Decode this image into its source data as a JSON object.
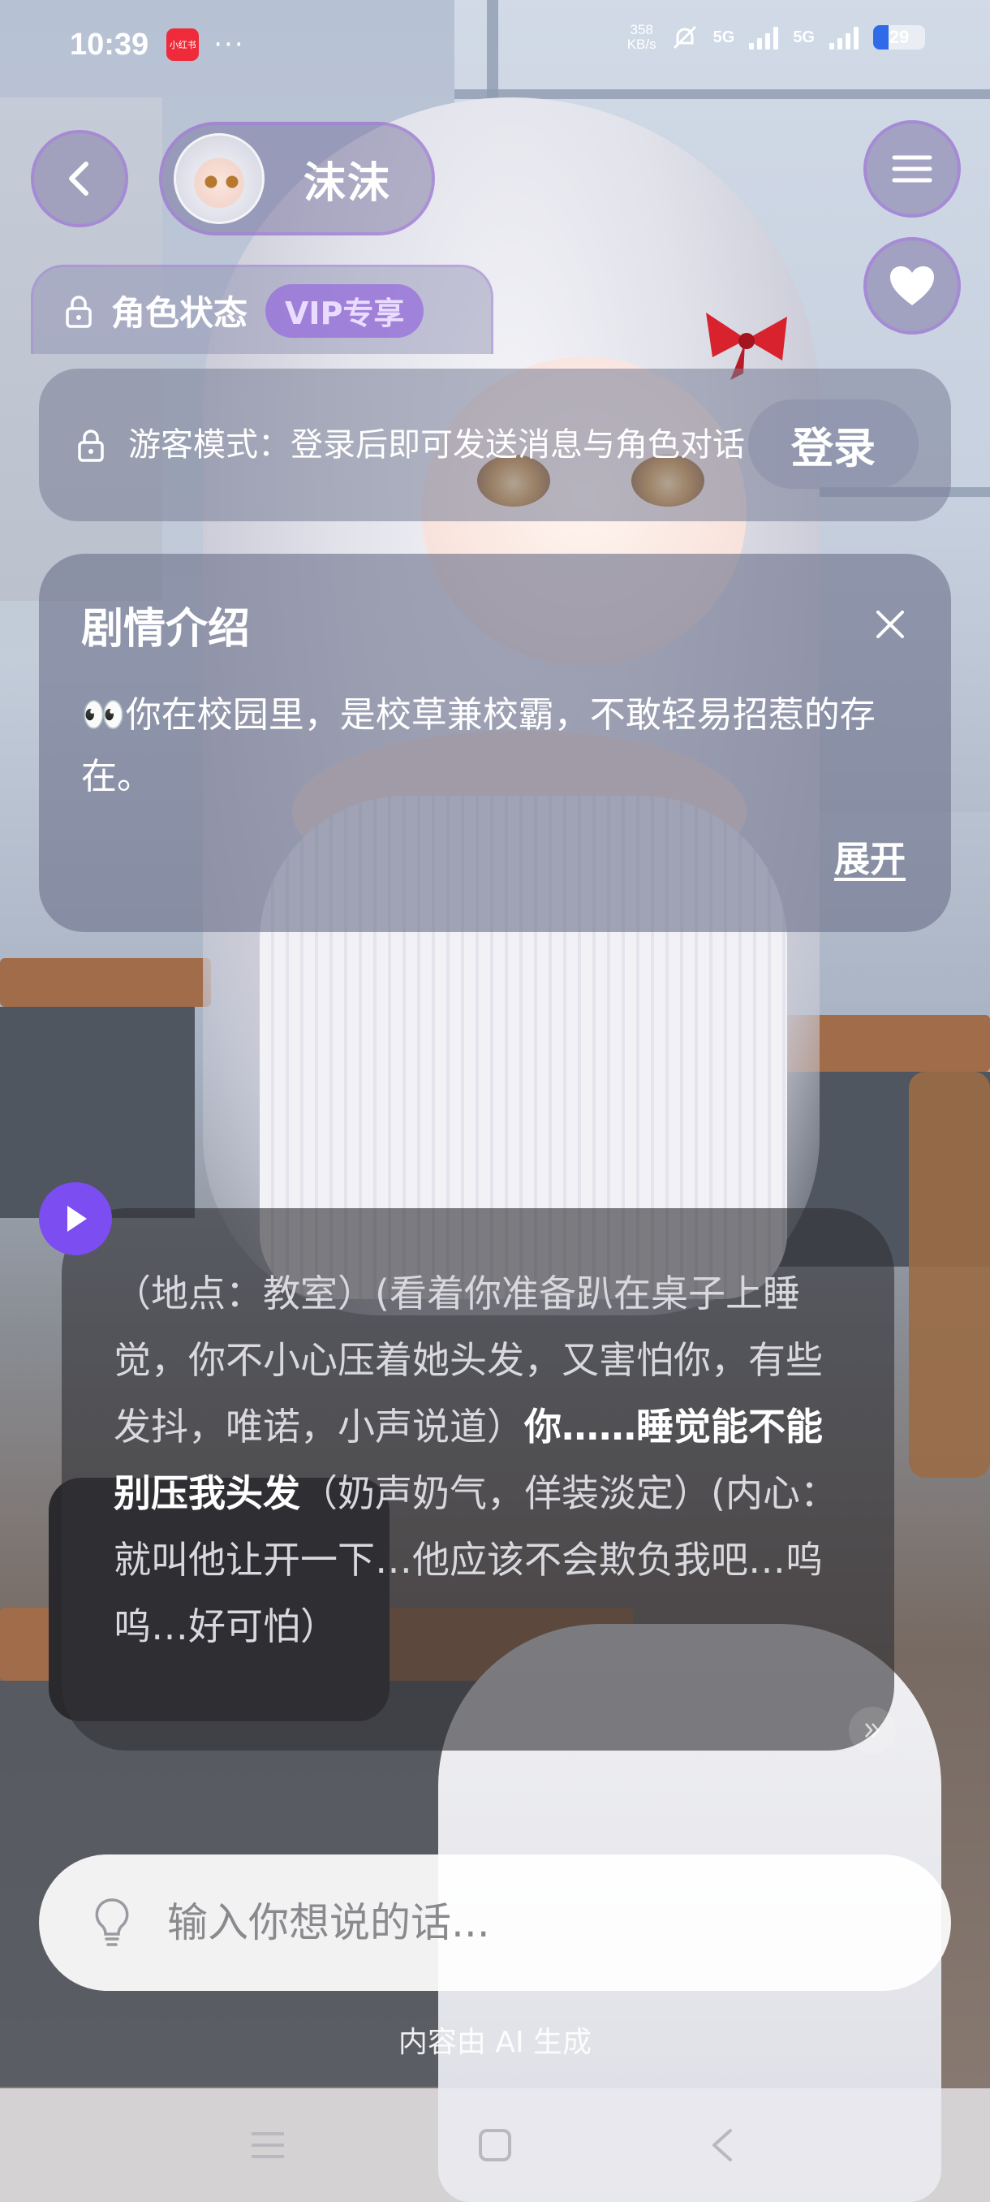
{
  "status_bar": {
    "time": "10:39",
    "app_badge": "小红书",
    "more": "···",
    "net_speed_value": "358",
    "net_speed_unit": "KB/s",
    "net_type_1": "5G",
    "net_type_2": "5G",
    "battery": "29",
    "battery_level": 0.29,
    "battery_color": "#2f6be8"
  },
  "header": {
    "character_name": "沫沫"
  },
  "role_status": {
    "label": "角色状态",
    "vip_badge": "VIP专享"
  },
  "guest_notice": {
    "text": "游客模式：登录后即可发送消息与角色对话",
    "login_label": "登录"
  },
  "plot_intro": {
    "title": "剧情介绍",
    "text": "👀你在校园里，是校草兼校霸，不敢轻易招惹的存在。",
    "expand_label": "展开"
  },
  "message": {
    "narration": "（地点：教室）(看着你准备趴在桌子上睡觉，你不小心压着她头发，又害怕你，有些发抖，唯诺，小声说道）",
    "speech": "你……睡觉能不能别压我头发",
    "narration_2": "（奶声奶气，佯装淡定）(内心：就叫他让开一下…他应该不会欺负我吧…呜呜…好可怕）"
  },
  "input": {
    "placeholder": "输入你想说的话..."
  },
  "footer": {
    "ai_note": "内容由 AI 生成"
  },
  "icons": {
    "back": "chevron-left-icon",
    "menu": "hamburger-menu-icon",
    "favorite": "heart-icon",
    "lock": "lock-icon",
    "close": "close-icon",
    "play": "play-icon",
    "hint": "lightbulb-icon"
  },
  "colors": {
    "accent_purple": "#7c4df0",
    "vip_badge_bg": "#9a6edc"
  }
}
